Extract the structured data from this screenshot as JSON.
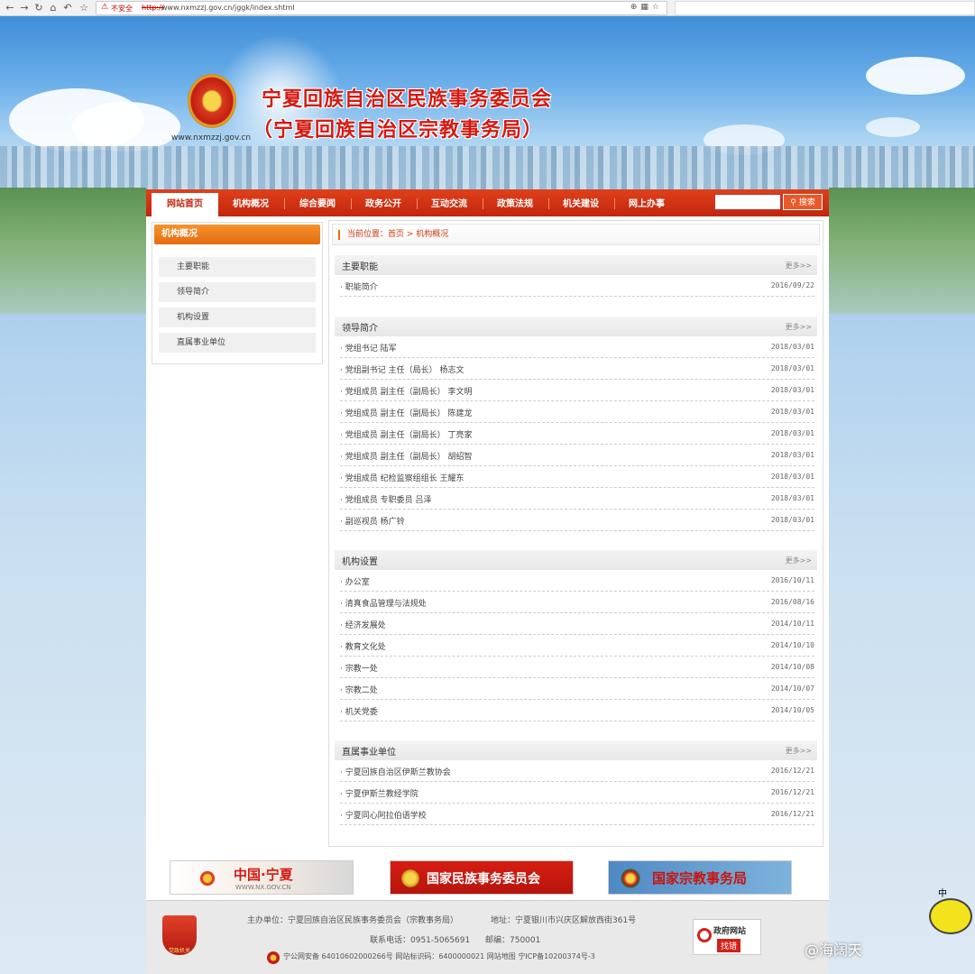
{
  "browser": {
    "insecure_label": "不安全",
    "url_proto": "http://",
    "url": "www.nxmzzj.gov.cn/jggk/index.shtml"
  },
  "header": {
    "title_line1": "宁夏回族自治区民族事务委员会",
    "title_line2": "（宁夏回族自治区宗教事务局）",
    "site_url": "www.nxmzzj.gov.cn"
  },
  "nav": {
    "items": [
      "网站首页",
      "机构概况",
      "综合要闻",
      "政务公开",
      "互动交流",
      "政策法规",
      "机关建设",
      "网上办事"
    ],
    "search_button": "搜索"
  },
  "sidebar": {
    "title": "机构概况",
    "items": [
      "主要职能",
      "领导简介",
      "机构设置",
      "直属事业单位"
    ]
  },
  "breadcrumb": "当前位置：首页 > 机构概况",
  "more_label": "更多>>",
  "sections": [
    {
      "title": "主要职能",
      "rows": [
        {
          "text": "职能简介",
          "date": "2016/09/22"
        }
      ]
    },
    {
      "title": "领导简介",
      "rows": [
        {
          "text": "党组书记  陆军",
          "date": "2018/03/01"
        },
        {
          "text": "党组副书记  主任（局长）  杨志文",
          "date": "2018/03/01"
        },
        {
          "text": "党组成员  副主任（副局长）  李文明",
          "date": "2018/03/01"
        },
        {
          "text": "党组成员  副主任（副局长）  陈建龙",
          "date": "2018/03/01"
        },
        {
          "text": "党组成员  副主任（副局长）  丁亮家",
          "date": "2018/03/01"
        },
        {
          "text": "党组成员  副主任（副局长）  胡绍智",
          "date": "2018/03/01"
        },
        {
          "text": "党组成员  纪检监察组组长  王耀东",
          "date": "2018/03/01"
        },
        {
          "text": "党组成员  专职委员  吕泽",
          "date": "2018/03/01"
        },
        {
          "text": "副巡视员  杨广铃",
          "date": "2018/03/01"
        }
      ]
    },
    {
      "title": "机构设置",
      "rows": [
        {
          "text": "办公室",
          "date": "2016/10/11"
        },
        {
          "text": "清真食品管理与法规处",
          "date": "2016/08/16"
        },
        {
          "text": "经济发展处",
          "date": "2014/10/11"
        },
        {
          "text": "教育文化处",
          "date": "2014/10/10"
        },
        {
          "text": "宗教一处",
          "date": "2014/10/08"
        },
        {
          "text": "宗教二处",
          "date": "2014/10/07"
        },
        {
          "text": "机关党委",
          "date": "2014/10/05"
        }
      ]
    },
    {
      "title": "直属事业单位",
      "rows": [
        {
          "text": "宁夏回族自治区伊斯兰教协会",
          "date": "2016/12/21"
        },
        {
          "text": "宁夏伊斯兰教经学院",
          "date": "2016/12/21"
        },
        {
          "text": "宁夏同心阿拉伯语学校",
          "date": "2016/12/21"
        }
      ]
    }
  ],
  "link_banners": {
    "b1_title": "中国·宁夏",
    "b1_sub": "WWW.NX.GOV.CN",
    "b2_title": "国家民族事务委员会",
    "b3_title": "国家宗教事务局"
  },
  "footer": {
    "line1_host": "主办单位：宁夏回族自治区民族事务委员会（宗教事务局）",
    "line1_addr": "地址：宁夏银川市兴庆区解放西街361号",
    "line2_tel": "联系电话：0951-5065691",
    "line2_zip": "邮编：750001",
    "line3": "宁公网安备 64010602000266号   网站标识码：6400000021   网站地图     宁ICP备10200374号-3",
    "badge_text": "党政机关",
    "gov_line1": "政府网站",
    "gov_line2": "找错"
  },
  "watermark": "@海阔天",
  "mascot_char": "中"
}
